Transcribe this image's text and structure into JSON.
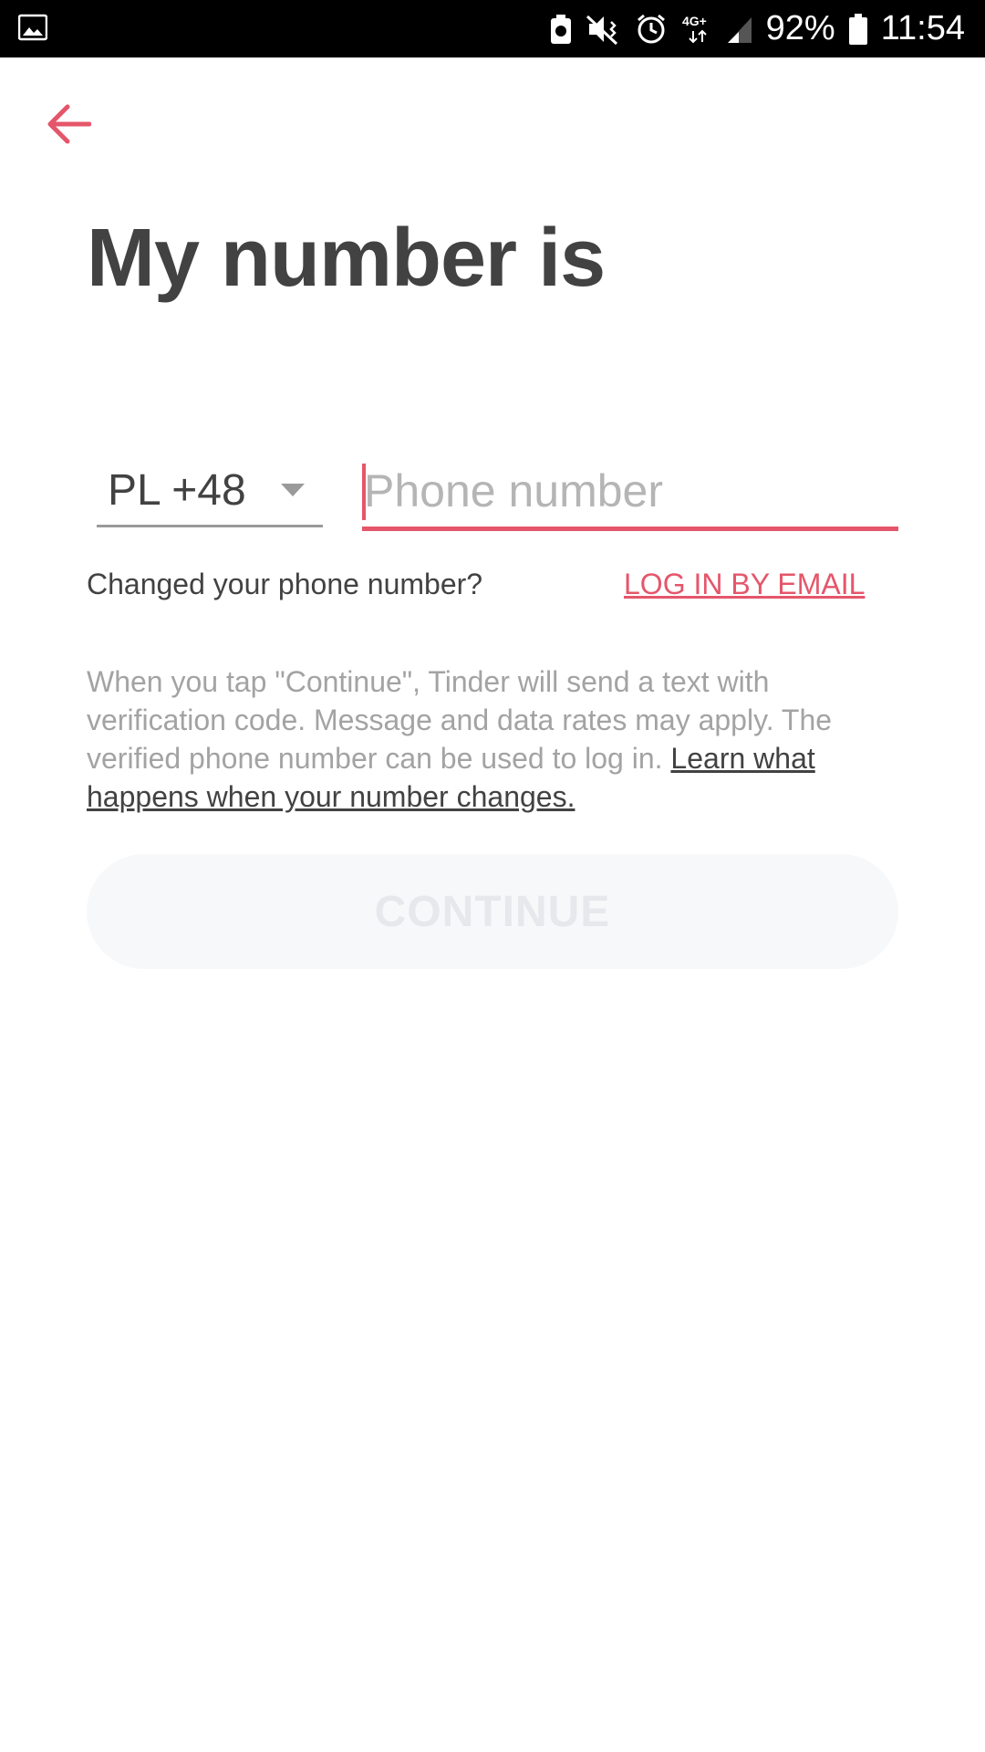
{
  "status_bar": {
    "battery": "92%",
    "time": "11:54",
    "network": "4G+"
  },
  "page": {
    "title": "My number is",
    "country_code": "PL +48",
    "phone_placeholder": "Phone number",
    "phone_value": "",
    "changed_question": "Changed your phone number?",
    "email_login": "LOG IN BY EMAIL",
    "disclaimer": "When you tap \"Continue\", Tinder will send a text with verification code. Message and data rates may apply. The verified phone number can be used to log in.",
    "learn_link": "Learn what happens when your number changes.",
    "continue_label": "CONTINUE"
  },
  "colors": {
    "accent": "#e5566a",
    "title": "#424242",
    "muted": "#a3a3a3",
    "button_bg": "#f7f8fa",
    "button_text": "#e6e8ec"
  }
}
